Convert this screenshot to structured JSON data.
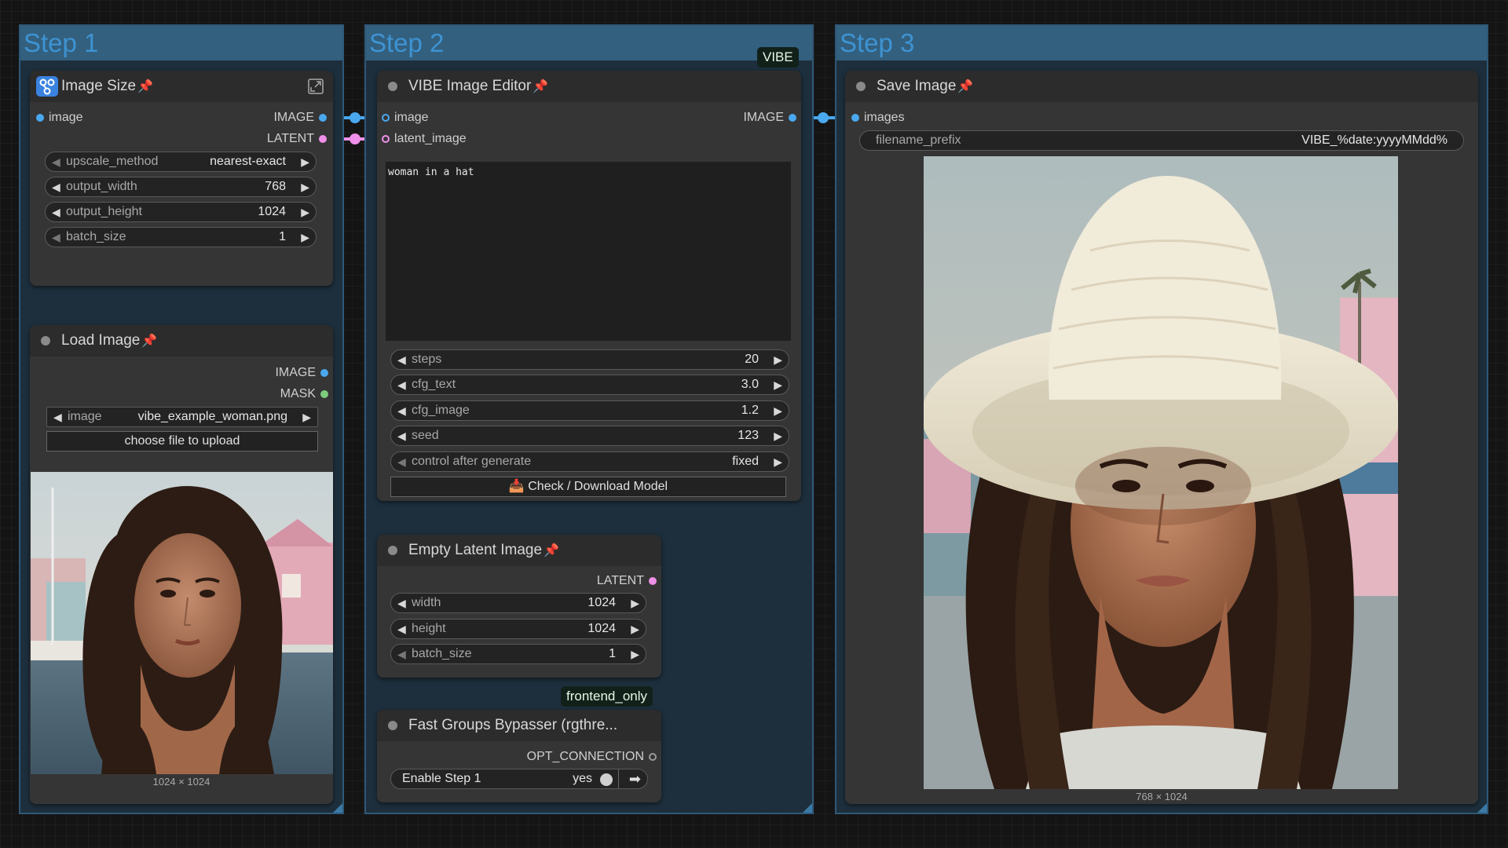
{
  "groups": {
    "step1": "Step 1",
    "step2": "Step 2",
    "step3": "Step 3"
  },
  "badges": {
    "vibe": "VIBE",
    "frontend_only": "frontend_only"
  },
  "colors": {
    "group_bg": "#1d2f3d",
    "group_header": "#33607f",
    "image_link": "#4aa8ee",
    "latent_link": "#f090e8",
    "mask_slot": "#7ccc7c"
  },
  "nodes": {
    "image_size": {
      "title": "Image Size",
      "pin": "📌",
      "icon": "node-graph-icon",
      "inputs": [
        "image"
      ],
      "outputs": [
        "IMAGE",
        "LATENT"
      ],
      "widgets": [
        {
          "label": "upscale_method",
          "value": "nearest-exact"
        },
        {
          "label": "output_width",
          "value": "768"
        },
        {
          "label": "output_height",
          "value": "1024"
        },
        {
          "label": "batch_size",
          "value": "1"
        }
      ]
    },
    "load_image": {
      "title": "Load Image",
      "pin": "📌",
      "outputs": [
        "IMAGE",
        "MASK"
      ],
      "widget": {
        "label": "image",
        "value": "vibe_example_woman.png"
      },
      "upload_button": "choose file to upload",
      "caption": "1024 × 1024"
    },
    "vibe_editor": {
      "title": "VIBE Image Editor",
      "pin": "📌",
      "inputs": [
        "image",
        "latent_image"
      ],
      "outputs": [
        "IMAGE"
      ],
      "prompt": "woman in a hat",
      "widgets": [
        {
          "label": "steps",
          "value": "20"
        },
        {
          "label": "cfg_text",
          "value": "3.0"
        },
        {
          "label": "cfg_image",
          "value": "1.2"
        },
        {
          "label": "seed",
          "value": "123"
        },
        {
          "label": "control after generate",
          "value": "fixed"
        }
      ],
      "button": "📥 Check / Download Model"
    },
    "empty_latent": {
      "title": "Empty Latent Image",
      "pin": "📌",
      "outputs": [
        "LATENT"
      ],
      "widgets": [
        {
          "label": "width",
          "value": "1024"
        },
        {
          "label": "height",
          "value": "1024"
        },
        {
          "label": "batch_size",
          "value": "1"
        }
      ]
    },
    "bypasser": {
      "title": "Fast Groups Bypasser (rgthre...",
      "outputs": [
        "OPT_CONNECTION"
      ],
      "toggle": {
        "label": "Enable Step 1",
        "value": "yes"
      }
    },
    "save_image": {
      "title": "Save Image",
      "pin": "📌",
      "inputs": [
        "images"
      ],
      "widget": {
        "label": "filename_prefix",
        "value": "VIBE_%date:yyyyMMdd%"
      },
      "caption": "768 × 1024"
    }
  }
}
